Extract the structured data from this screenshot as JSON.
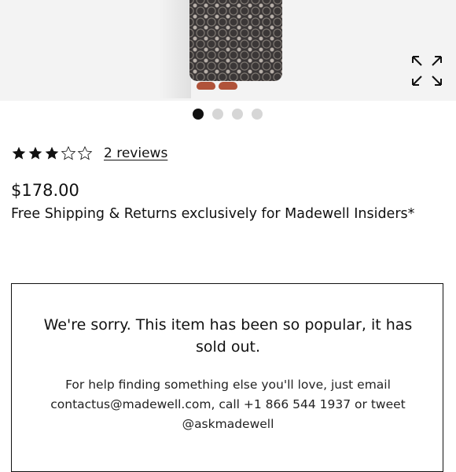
{
  "product": {
    "price": "$178.00",
    "shipping": "Free Shipping & Returns exclusively for Madewell Insiders*"
  },
  "gallery": {
    "dots_count": 4,
    "active_index": 0,
    "expand_icon": "expand-arrows-icon"
  },
  "rating": {
    "value": 3,
    "max": 5,
    "reviews_label": "2 reviews"
  },
  "soldout": {
    "title": "We're sorry. This item has been so popular, it has sold out.",
    "help": "For help finding something else you'll love, just email contactus@madewell.com, call +1 866 544 1937 or tweet @askmadewell"
  },
  "colors": {
    "text": "#111111",
    "dot_inactive": "#d6d6d6",
    "border": "#111111"
  }
}
